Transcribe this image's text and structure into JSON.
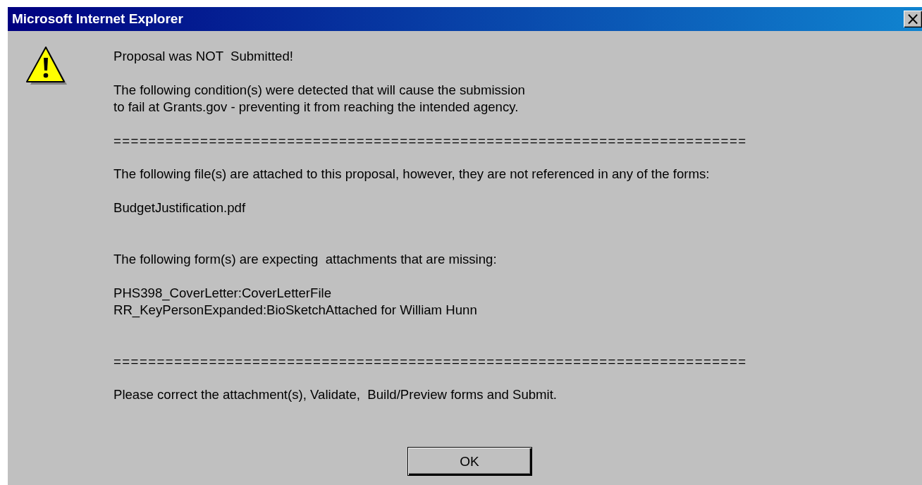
{
  "window": {
    "title": "Microsoft Internet Explorer",
    "close_label": "×"
  },
  "message": {
    "heading": "Proposal was NOT  Submitted!",
    "blocks": [
      {
        "kind": "text",
        "lines": [
          "The following condition(s) were detected that will cause the submission",
          "to fail at Grants.gov - preventing it from reaching the intended agency."
        ]
      },
      {
        "kind": "rule",
        "lines": [
          "========================================================================="
        ]
      },
      {
        "kind": "text",
        "lines": [
          "The following file(s) are attached to this proposal, however, they are not referenced in any of the forms:"
        ]
      },
      {
        "kind": "list",
        "lines": [
          "BudgetJustification.pdf"
        ]
      },
      {
        "kind": "text",
        "lines": [
          "The following form(s) are expecting  attachments that are missing:"
        ]
      },
      {
        "kind": "list",
        "lines": [
          "PHS398_CoverLetter:CoverLetterFile",
          "RR_KeyPersonExpanded:BioSketchAttached for William Hunn"
        ]
      },
      {
        "kind": "rule",
        "lines": [
          "========================================================================="
        ]
      },
      {
        "kind": "text",
        "lines": [
          "Please correct the attachment(s), Validate,  Build/Preview forms and Submit."
        ]
      }
    ]
  },
  "buttons": [
    "OK"
  ]
}
